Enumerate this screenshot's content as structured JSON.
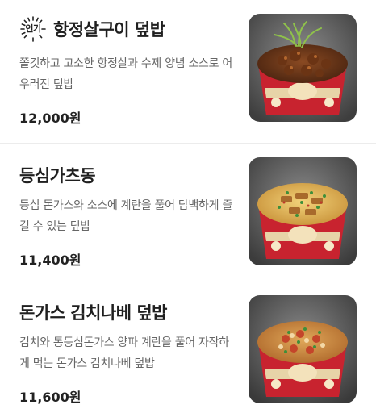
{
  "menu": {
    "items": [
      {
        "badge": "인기",
        "title": "항정살구이 덮밥",
        "desc": "쫄깃하고 고소한 항정살과 수제 양념 소스로 어우러진 덮밥",
        "price": "12,000원",
        "image": "pork-jowl-rice-bowl-photo"
      },
      {
        "title": "등심가츠동",
        "desc": "등심 돈가스와 소스에 계란을 풀어 담백하게 즐길 수 있는 덮밥",
        "price": "11,400원",
        "image": "pork-loin-katsudon-photo"
      },
      {
        "title": "돈가스 김치나베 덮밥",
        "desc": "김치와 통등심돈가스 양파 계란을 풀어 자작하게 먹는 돈가스 김치나베 덮밥",
        "price": "11,600원",
        "image": "kimchi-nabe-katsu-bowl-photo"
      }
    ]
  }
}
